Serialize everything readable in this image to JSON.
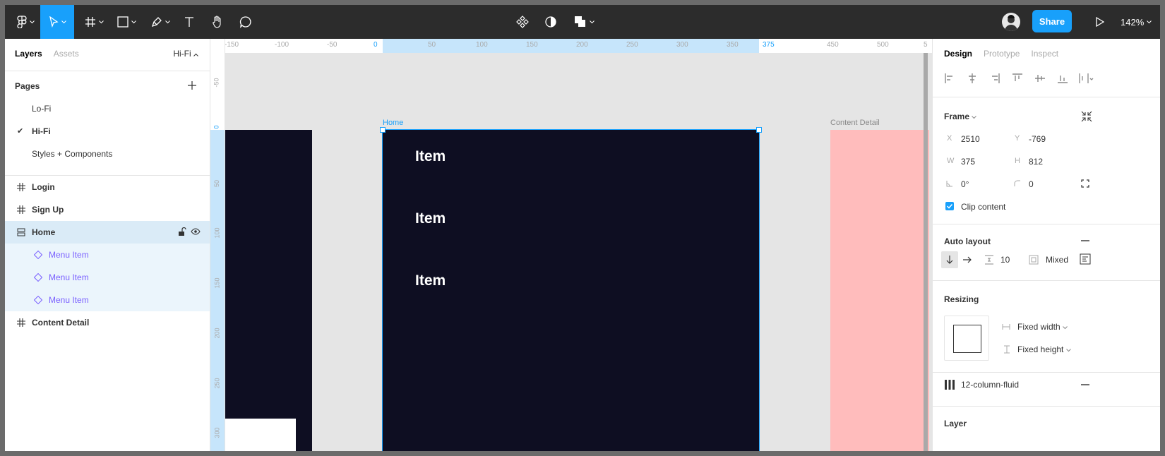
{
  "toolbar": {
    "share_label": "Share",
    "zoom_label": "142%"
  },
  "left_panel": {
    "tabs": [
      "Layers",
      "Assets"
    ],
    "current_page_switch": "Hi-Fi",
    "pages_title": "Pages",
    "pages": [
      {
        "label": "Lo-Fi",
        "selected": false
      },
      {
        "label": "Hi-Fi",
        "selected": true
      },
      {
        "label": "Styles + Components",
        "selected": false
      }
    ],
    "layers": [
      {
        "label": "Login",
        "type": "frame",
        "state": "normal"
      },
      {
        "label": "Sign Up",
        "type": "frame",
        "state": "normal"
      },
      {
        "label": "Home",
        "type": "autolayout-frame",
        "state": "selected"
      },
      {
        "label": "Menu Item",
        "type": "instance",
        "state": "child"
      },
      {
        "label": "Menu Item",
        "type": "instance",
        "state": "child"
      },
      {
        "label": "Menu Item",
        "type": "instance",
        "state": "child"
      },
      {
        "label": "Content Detail",
        "type": "frame",
        "state": "normal"
      }
    ]
  },
  "canvas": {
    "ruler_top_ticks": [
      "-150",
      "-100",
      "-50",
      "0",
      "50",
      "100",
      "150",
      "200",
      "250",
      "300",
      "350",
      "375",
      "450",
      "500",
      "5"
    ],
    "ruler_left_ticks": [
      "-50",
      "0",
      "50",
      "100",
      "150",
      "200",
      "250",
      "300"
    ],
    "home_label": "Home",
    "content_detail_label": "Content Detail",
    "items": [
      "Item",
      "Item",
      "Item"
    ],
    "colors": {
      "frame_dark": "#0e0e22",
      "content_pink": "#ffbcbc",
      "selection_blue": "#18a0fb"
    }
  },
  "right_panel": {
    "tabs": [
      "Design",
      "Prototype",
      "Inspect"
    ],
    "frame": {
      "title": "Frame",
      "x_label": "X",
      "x": "2510",
      "y_label": "Y",
      "y": "-769",
      "w_label": "W",
      "w": "375",
      "h_label": "H",
      "h": "812",
      "rotation": "0°",
      "radius": "0",
      "clip_content_label": "Clip content",
      "clip_content": true
    },
    "auto_layout": {
      "title": "Auto layout",
      "spacing": "10",
      "padding": "Mixed"
    },
    "resizing": {
      "title": "Resizing",
      "width": "Fixed width",
      "height": "Fixed height"
    },
    "layout_grid": {
      "name": "12-column-fluid"
    },
    "layer": {
      "title": "Layer"
    }
  }
}
